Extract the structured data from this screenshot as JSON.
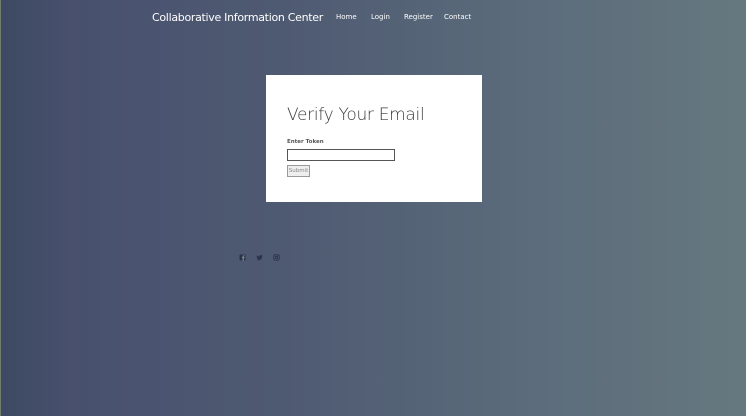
{
  "navbar": {
    "brand": "Collaborative Information Center",
    "links": [
      {
        "label": "Home"
      },
      {
        "label": "Login"
      },
      {
        "label": "Register"
      },
      {
        "label": "Contact"
      }
    ]
  },
  "verify": {
    "title": "Verify Your Email",
    "token_label": "Enter Token",
    "token_value": "",
    "submit_label": "Submit"
  },
  "footer": {
    "social_icons": [
      "facebook-icon",
      "twitter-icon",
      "instagram-icon"
    ]
  },
  "colors": {
    "background_start": "#3d4a62",
    "background_end": "#66787f",
    "card": "#ffffff",
    "text_dark": "#3a3a3a"
  }
}
